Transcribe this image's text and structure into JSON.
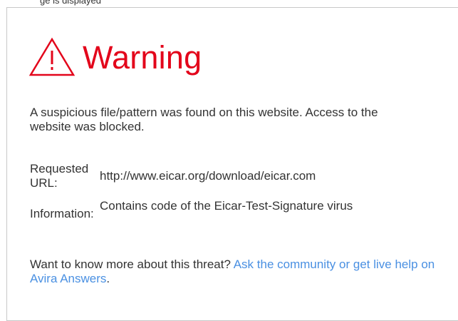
{
  "top_strip": {
    "text": "ge is displayed"
  },
  "warning": {
    "icon": "warning-triangle-icon",
    "title": "Warning",
    "color": "#e3051b"
  },
  "message": "A suspicious file/pattern was found on this website. Access to the website was blocked.",
  "details": {
    "url_label": "Requested URL:",
    "url_value": "http://www.eicar.org/download/eicar.com",
    "info_label": "Information:",
    "info_value": "Contains code of the Eicar-Test-Signature virus"
  },
  "footer": {
    "text": "Want to know more about this threat? ",
    "link_text": "Ask the community or get live help on Avira Answers",
    "trailing": ".",
    "link_color": "#4a90e2"
  }
}
